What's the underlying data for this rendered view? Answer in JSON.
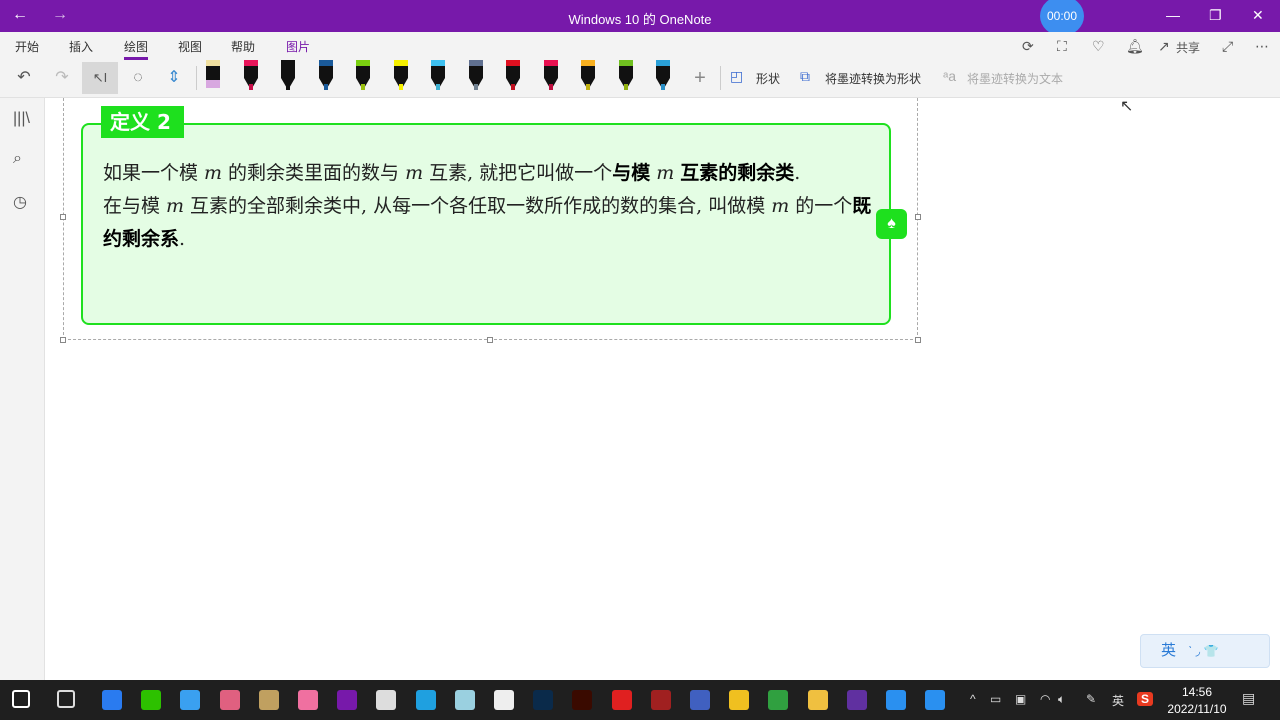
{
  "window": {
    "title": "Windows 10 的 OneNote",
    "back": "←",
    "forward": "→",
    "recording": "00:00",
    "minimize": "—",
    "restore": "❐",
    "close": "✕"
  },
  "ribbon": {
    "tabs": [
      {
        "label": "开始"
      },
      {
        "label": "插入"
      },
      {
        "label": "绘图"
      },
      {
        "label": "视图"
      },
      {
        "label": "帮助"
      },
      {
        "label": "图片"
      }
    ],
    "active_tab": "绘图",
    "share_label": "共享",
    "pens": [
      {
        "name": "eraser",
        "cap": "#f0e0a0",
        "body": "#111",
        "tip": "#d8a8e0"
      },
      {
        "name": "pen-pink",
        "cap": "#e8155a",
        "body": "#111",
        "tip": "#c8104a"
      },
      {
        "name": "pen-black",
        "cap": "#111",
        "body": "#111",
        "tip": "#111"
      },
      {
        "name": "pen-dark-blue",
        "cap": "#1a5a9a",
        "body": "#111",
        "tip": "#1a5a9a"
      },
      {
        "name": "pen-green",
        "cap": "#7ad010",
        "body": "#111",
        "tip": "#9ac010"
      },
      {
        "name": "highlighter-yellow",
        "cap": "#f6f000",
        "body": "#111",
        "tip": "#f6f000"
      },
      {
        "name": "pen-light-blue",
        "cap": "#3ec0f0",
        "body": "#111",
        "tip": "#3eb0d0"
      },
      {
        "name": "pen-galaxy",
        "cap": "#607090",
        "body": "#111",
        "tip": "#708090"
      },
      {
        "name": "pen-red",
        "cap": "#e01020",
        "body": "#111",
        "tip": "#c01020"
      },
      {
        "name": "pen-crimson",
        "cap": "#e81050",
        "body": "#111",
        "tip": "#c01040"
      },
      {
        "name": "pen-orange",
        "cap": "#f8b020",
        "body": "#111",
        "tip": "#c0b010"
      },
      {
        "name": "pen-lime",
        "cap": "#70c020",
        "body": "#111",
        "tip": "#90b010"
      },
      {
        "name": "pen-cyan",
        "cap": "#2aa0d8",
        "body": "#111",
        "tip": "#2a90c8"
      }
    ],
    "add_pen": "+",
    "shapes_label": "形状",
    "ink_to_shape_label": "将墨迹转换为形状",
    "ink_to_text_label": "将墨迹转换为文本"
  },
  "note": {
    "tag": "定义 2",
    "para1": [
      {
        "t": "如果一个模",
        "s": "n"
      },
      {
        "t": "m",
        "s": "m"
      },
      {
        "t": "的剩余类里面的数与",
        "s": "n"
      },
      {
        "t": "m",
        "s": "m"
      },
      {
        "t": "互素, 就把它叫做一个",
        "s": "n"
      },
      {
        "t": "与模",
        "s": "b"
      },
      {
        "t": "m",
        "s": "m"
      },
      {
        "t": "互素的剩余类",
        "s": "b"
      },
      {
        "t": ".",
        "s": "n"
      }
    ],
    "para2": [
      {
        "t": "在与模",
        "s": "n"
      },
      {
        "t": "m",
        "s": "m"
      },
      {
        "t": "互素的全部剩余类中, 从每一个各任取一数所作成的数的集合, 叫做模",
        "s": "n"
      },
      {
        "t": "m",
        "s": "m"
      },
      {
        "t": "的一个",
        "s": "n"
      },
      {
        "t": "既约剩余系",
        "s": "b"
      },
      {
        "t": ".",
        "s": "n"
      }
    ]
  },
  "ime": {
    "lang": "英",
    "extra": "ˋ ◞ 👕"
  },
  "taskbar": {
    "icons": [
      {
        "name": "start-icon",
        "color": "#ffffff"
      },
      {
        "name": "task-view-icon",
        "color": "#dddddd"
      },
      {
        "name": "feishu-icon",
        "color": "#2a7bf0"
      },
      {
        "name": "wechat-icon",
        "color": "#2dc100"
      },
      {
        "name": "browser-360-icon",
        "color": "#3aa0f0"
      },
      {
        "name": "app-7x-icon",
        "color": "#e06080"
      },
      {
        "name": "paint-icon",
        "color": "#c0a060"
      },
      {
        "name": "app-pink-icon",
        "color": "#f070a0"
      },
      {
        "name": "onenote-icon",
        "color": "#7719aa"
      },
      {
        "name": "remote-desktop-icon",
        "color": "#dddddd"
      },
      {
        "name": "edge-icon",
        "color": "#1fa0e0"
      },
      {
        "name": "app-flower-icon",
        "color": "#9ad0e0"
      },
      {
        "name": "inkscape-icon",
        "color": "#eeeeee"
      },
      {
        "name": "photoshop-icon",
        "color": "#0a2a4a"
      },
      {
        "name": "illustrator-icon",
        "color": "#3a0a00"
      },
      {
        "name": "wps-icon",
        "color": "#e02020"
      },
      {
        "name": "app-red-icon",
        "color": "#a02020"
      },
      {
        "name": "app-circle-icon",
        "color": "#4060c0"
      },
      {
        "name": "qq-icon",
        "color": "#f0c020"
      },
      {
        "name": "app-green-red-icon",
        "color": "#30a040"
      },
      {
        "name": "file-explorer-icon",
        "color": "#f0c040"
      },
      {
        "name": "app-purple-icon",
        "color": "#6030a0"
      },
      {
        "name": "app-q-icon",
        "color": "#2a90f0"
      },
      {
        "name": "app-q2-icon",
        "color": "#2a90f0"
      }
    ],
    "tray_label": "英",
    "time": "14:56",
    "date": "2022/11/10"
  }
}
